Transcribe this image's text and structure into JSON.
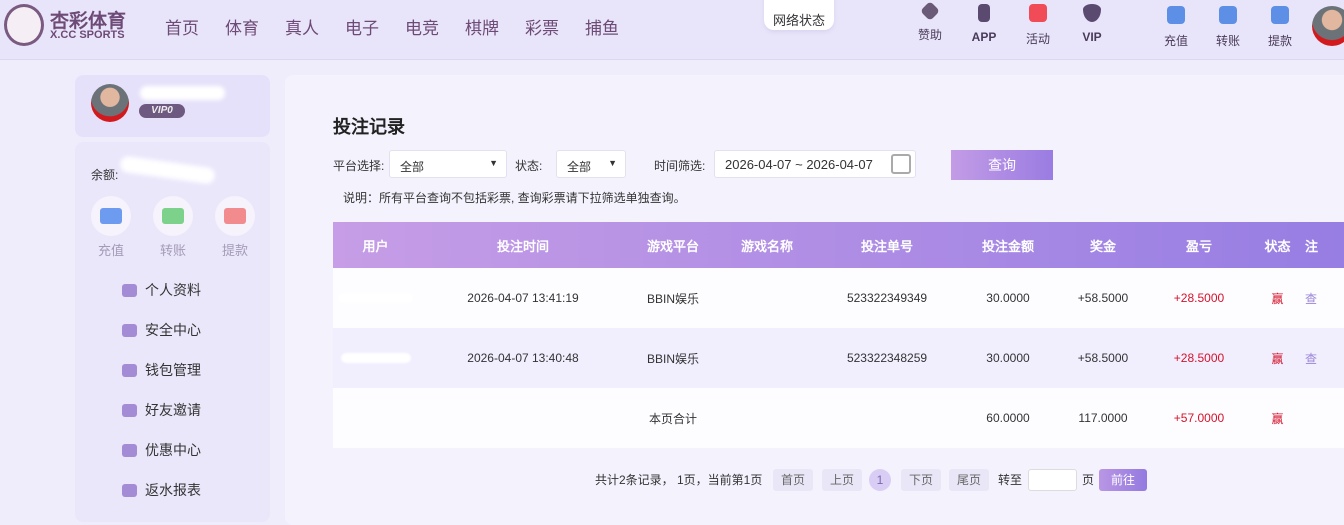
{
  "header": {
    "brand_cn": "杏彩体育",
    "brand_en": "X.CC SPORTS",
    "nav": [
      "首页",
      "体育",
      "真人",
      "电子",
      "电竞",
      "棋牌",
      "彩票",
      "捕鱼"
    ],
    "network_status": "网络状态",
    "tools": [
      "赞助",
      "APP",
      "活动",
      "VIP"
    ],
    "wallet": [
      "充值",
      "转账",
      "提款"
    ]
  },
  "sidebar": {
    "vip": "VIP0",
    "balance_label": "余额:",
    "quick": [
      "充值",
      "转账",
      "提款"
    ],
    "menu": [
      "个人资料",
      "安全中心",
      "钱包管理",
      "好友邀请",
      "优惠中心",
      "返水报表"
    ]
  },
  "main": {
    "title": "投注记录",
    "platform_label": "平台选择:",
    "platform_value": "全部",
    "status_label": "状态:",
    "status_value": "全部",
    "time_label": "时间筛选:",
    "date_range": "2026-04-07 ~ 2026-04-07",
    "query": "查询",
    "note": "说明：所有平台查询不包括彩票, 查询彩票请下拉筛选单独查询。",
    "columns": [
      "用户",
      "投注时间",
      "游戏平台",
      "游戏名称",
      "投注单号",
      "投注金额",
      "奖金",
      "盈亏",
      "状态",
      "注"
    ],
    "rows": [
      {
        "time": "2026-04-07 13:41:19",
        "platform": "BBIN娱乐",
        "game": "",
        "order": "523322349349",
        "amount": "30.0000",
        "bonus": "+58.5000",
        "profit": "+28.5000",
        "status": "赢",
        "action": "查"
      },
      {
        "time": "2026-04-07 13:40:48",
        "platform": "BBIN娱乐",
        "game": "",
        "order": "523322348259",
        "amount": "30.0000",
        "bonus": "+58.5000",
        "profit": "+28.5000",
        "status": "赢",
        "action": "查"
      }
    ],
    "total": {
      "label": "本页合计",
      "amount": "60.0000",
      "bonus": "117.0000",
      "profit": "+57.0000",
      "status": "赢"
    },
    "pagination": {
      "summary": "共计2条记录， 1页，当前第1页",
      "first": "首页",
      "prev": "上页",
      "current": "1",
      "next": "下页",
      "last": "尾页",
      "goto": "转至",
      "page_unit": "页",
      "go": "前往"
    }
  },
  "colors": {
    "accent": "#9a7ce2",
    "win": "#d5132b"
  }
}
